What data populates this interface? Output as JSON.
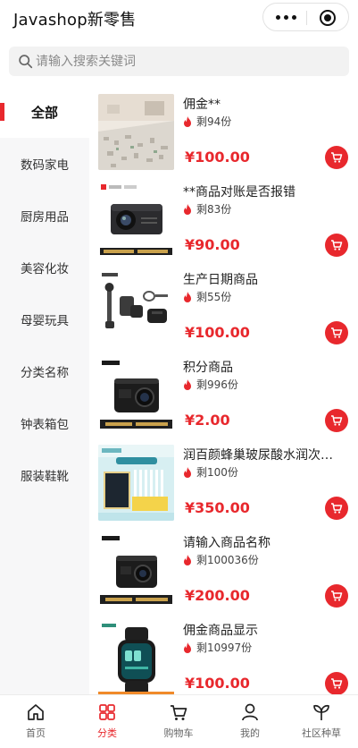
{
  "header": {
    "title": "Javashop新零售"
  },
  "search": {
    "placeholder": "请输入搜索关键词"
  },
  "sidebar": {
    "items": [
      {
        "label": "全部"
      },
      {
        "label": "数码家电"
      },
      {
        "label": "厨房用品"
      },
      {
        "label": "美容化妆"
      },
      {
        "label": "母婴玩具"
      },
      {
        "label": "分类名称"
      },
      {
        "label": "钟表箱包"
      },
      {
        "label": "服装鞋靴"
      }
    ]
  },
  "products": [
    {
      "name": "佣金**",
      "stock": "剩94份",
      "price": "¥100.00"
    },
    {
      "name": "**商品对账是否报错",
      "stock": "剩83份",
      "price": "¥90.00"
    },
    {
      "name": "生产日期商品",
      "stock": "剩55份",
      "price": "¥100.00"
    },
    {
      "name": "积分商品",
      "stock": "剩996份",
      "price": "¥2.00"
    },
    {
      "name": "润百颜蜂巢玻尿酸水润次抛原液",
      "stock": "剩100份",
      "price": "¥350.00"
    },
    {
      "name": "请输入商品名称",
      "stock": "剩100036份",
      "price": "¥200.00"
    },
    {
      "name": "佣金商品显示",
      "stock": "剩10997份",
      "price": "¥100.00"
    }
  ],
  "tabbar": {
    "items": [
      {
        "label": "首页"
      },
      {
        "label": "分类"
      },
      {
        "label": "购物车"
      },
      {
        "label": "我的"
      },
      {
        "label": "社区种草"
      }
    ]
  },
  "colors": {
    "accent": "#e8282d",
    "sidebar_bg": "#f7f7f8"
  }
}
